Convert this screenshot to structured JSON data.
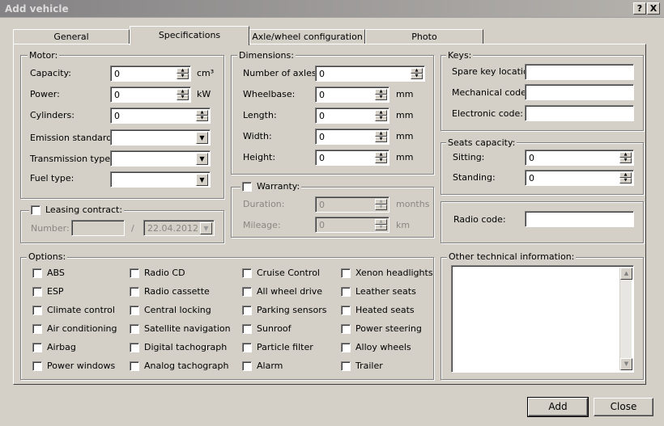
{
  "window": {
    "title": "Add vehicle",
    "help_label": "?",
    "close_label": "X"
  },
  "tabs": [
    {
      "label": "General"
    },
    {
      "label": "Specifications"
    },
    {
      "label": "Axle/wheel configuration"
    },
    {
      "label": "Photo"
    }
  ],
  "motor": {
    "legend": "Motor:",
    "capacity_label": "Capacity:",
    "capacity_value": "0",
    "capacity_unit": "cm³",
    "power_label": "Power:",
    "power_value": "0",
    "power_unit": "kW",
    "cylinders_label": "Cylinders:",
    "cylinders_value": "0",
    "emission_label": "Emission standard:",
    "emission_value": "",
    "transmission_label": "Transmission type:",
    "transmission_value": "",
    "fuel_label": "Fuel type:",
    "fuel_value": ""
  },
  "dimensions": {
    "legend": "Dimensions:",
    "axles_label": "Number of axles:",
    "axles_value": "0",
    "wheelbase_label": "Wheelbase:",
    "wheelbase_value": "0",
    "length_label": "Length:",
    "length_value": "0",
    "width_label": "Width:",
    "width_value": "0",
    "height_label": "Height:",
    "height_value": "0",
    "unit": "mm"
  },
  "keys": {
    "legend": "Keys:",
    "spare_label": "Spare key location:",
    "spare_value": "",
    "mechanical_label": "Mechanical code:",
    "mechanical_value": "",
    "electronic_label": "Electronic code:",
    "electronic_value": ""
  },
  "seats": {
    "legend": "Seats capacity:",
    "sitting_label": "Sitting:",
    "sitting_value": "0",
    "standing_label": "Standing:",
    "standing_value": "0"
  },
  "leasing": {
    "legend": "Leasing contract:",
    "number_label": "Number:",
    "number_value": "",
    "separator": "/",
    "date_value": "22.04.2012"
  },
  "warranty": {
    "legend": "Warranty:",
    "duration_label": "Duration:",
    "duration_value": "0",
    "duration_unit": "months",
    "mileage_label": "Mileage:",
    "mileage_value": "0",
    "mileage_unit": "km"
  },
  "radio": {
    "label": "Radio code:",
    "value": ""
  },
  "options": {
    "legend": "Options:",
    "columns": [
      [
        "ABS",
        "ESP",
        "Climate control",
        "Air conditioning",
        "Airbag",
        "Power windows"
      ],
      [
        "Radio CD",
        "Radio cassette",
        "Central locking",
        "Satellite navigation",
        "Digital tachograph",
        "Analog tachograph"
      ],
      [
        "Cruise Control",
        "All wheel drive",
        "Parking sensors",
        "Sunroof",
        "Particle filter",
        "Alarm"
      ],
      [
        "Xenon headlights",
        "Leather seats",
        "Heated seats",
        "Power steering",
        "Alloy wheels",
        "Trailer"
      ]
    ]
  },
  "other": {
    "legend": "Other technical information:",
    "value": ""
  },
  "buttons": {
    "add": "Add",
    "close": "Close"
  },
  "icons": {
    "spin_up": "▲",
    "spin_down": "▼",
    "dropdown": "▼"
  }
}
